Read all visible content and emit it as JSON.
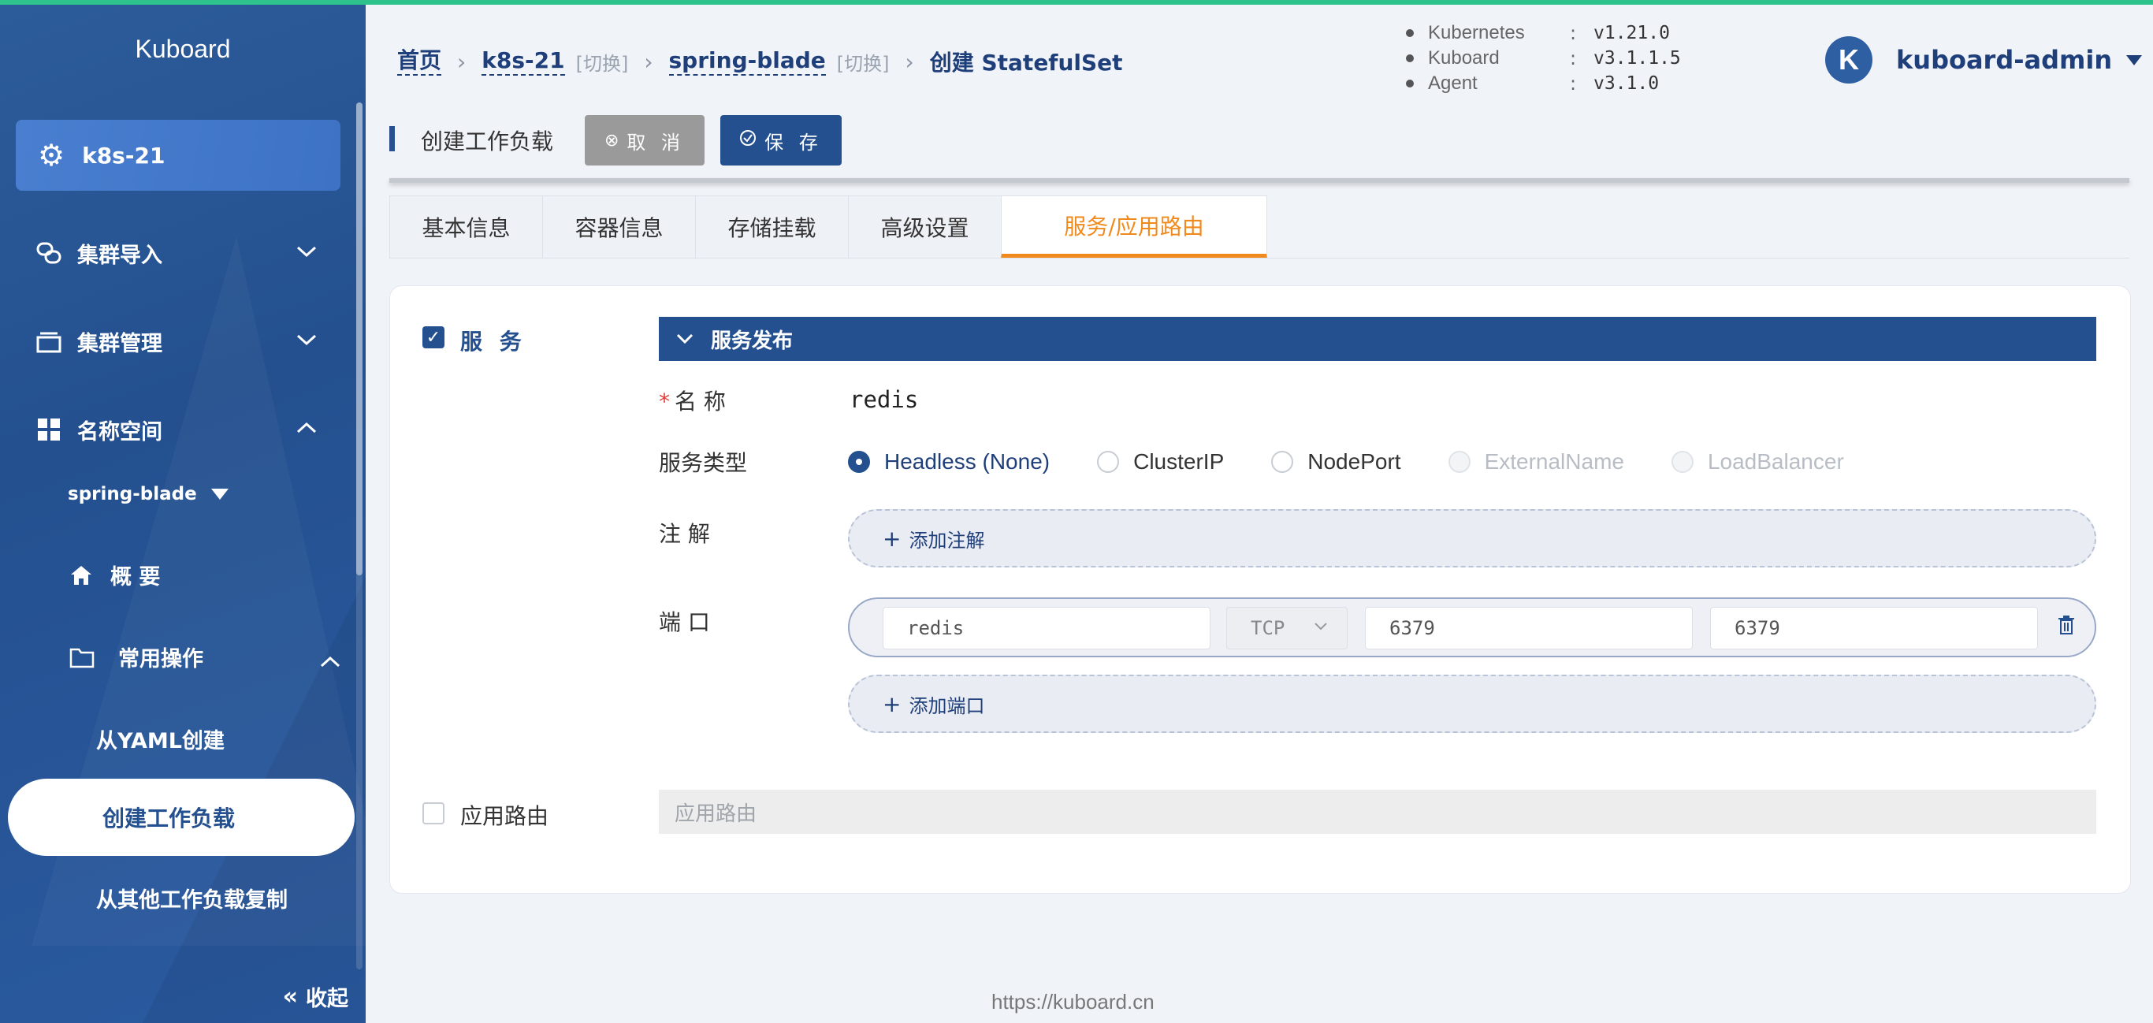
{
  "app": {
    "brand": "Kuboard",
    "footer_url": "https://kuboard.cn"
  },
  "sidebar": {
    "cluster": "k8s-21",
    "menu": [
      {
        "label": "集群导入",
        "icon": "link-icon",
        "expanded": false
      },
      {
        "label": "集群管理",
        "icon": "layers-icon",
        "expanded": false
      },
      {
        "label": "名称空间",
        "icon": "grid-icon",
        "expanded": true
      }
    ],
    "namespace": "spring-blade",
    "overview": "概 要",
    "common_ops": "常用操作",
    "leaves": [
      "从YAML创建",
      "创建工作负载",
      "从其他工作负载复制"
    ],
    "active_leaf": "创建工作负载",
    "collapse": "收起"
  },
  "breadcrumb": {
    "home": "首页",
    "cluster": "k8s-21",
    "cluster_switch": "[切换]",
    "namespace": "spring-blade",
    "namespace_switch": "[切换]",
    "current": "创建 StatefulSet"
  },
  "versions": [
    {
      "name": "Kubernetes",
      "value": "v1.21.0"
    },
    {
      "name": "Kuboard",
      "value": "v3.1.1.5"
    },
    {
      "name": "Agent",
      "value": "v3.1.0"
    }
  ],
  "user": {
    "initial": "K",
    "name": "kuboard-admin"
  },
  "toolbar": {
    "title": "创建工作负载",
    "cancel": "取 消",
    "save": "保 存"
  },
  "tabs": [
    "基本信息",
    "容器信息",
    "存储挂载",
    "高级设置",
    "服务/应用路由"
  ],
  "active_tab": "服务/应用路由",
  "service": {
    "checkbox_label": "服 务",
    "checked": true,
    "section_title": "服务发布",
    "name_label": "名 称",
    "name_value": "redis",
    "type_label": "服务类型",
    "types": [
      {
        "label": "Headless (None)",
        "state": "selected"
      },
      {
        "label": "ClusterIP",
        "state": "normal"
      },
      {
        "label": "NodePort",
        "state": "normal"
      },
      {
        "label": "ExternalName",
        "state": "disabled"
      },
      {
        "label": "LoadBalancer",
        "state": "disabled"
      }
    ],
    "annotation_label": "注 解",
    "add_annotation": "添加注解",
    "port_label": "端 口",
    "port": {
      "name": "redis",
      "protocol": "TCP",
      "port": "6379",
      "target_port": "6379"
    },
    "add_port": "添加端口"
  },
  "route": {
    "checkbox_label": "应用路由",
    "checked": false,
    "placeholder": "应用路由"
  },
  "colors": {
    "primary": "#24508f",
    "accent": "#f08a1d",
    "topline": "#2ec28d"
  }
}
